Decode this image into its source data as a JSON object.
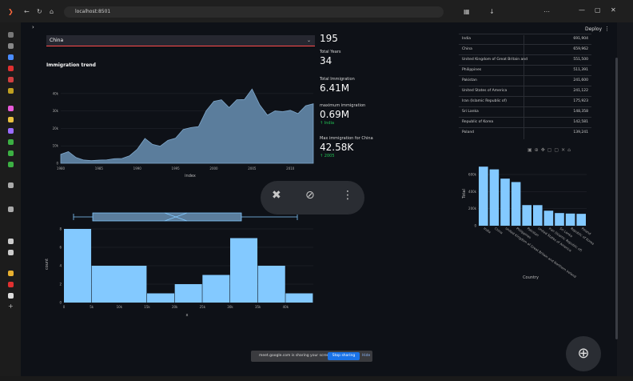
{
  "browser": {
    "url": "localhost:8501",
    "window_controls": [
      "—",
      "▢",
      "✕"
    ]
  },
  "header": {
    "deploy_label": "Deploy",
    "menu_label": "⋮",
    "sidebar_toggle": "›"
  },
  "country_select": {
    "value": "China"
  },
  "trend_chart": {
    "title": "Immigration trend",
    "xlabel": "index"
  },
  "metrics": {
    "top_value": "195",
    "total_years_label": "Total Years",
    "total_years_value": "34",
    "total_immigration_label": "Total Immigration",
    "total_immigration_value": "6.41M",
    "max_immigration_label": "maximum immigration",
    "max_immigration_value": "0.69M",
    "max_immigration_delta": "India",
    "max_for_country_label": "Max immigration for China",
    "max_for_country_value": "42.58K",
    "max_for_country_delta": "2005"
  },
  "top_table": {
    "rows": [
      {
        "country": "India",
        "value": "691,904"
      },
      {
        "country": "China",
        "value": "659,962"
      },
      {
        "country": "United Kingdom of Great Britain and",
        "value": "551,500"
      },
      {
        "country": "Philippines",
        "value": "511,391"
      },
      {
        "country": "Pakistan",
        "value": "241,600"
      },
      {
        "country": "United States of America",
        "value": "241,122"
      },
      {
        "country": "Iran (Islamic Republic of)",
        "value": "175,923"
      },
      {
        "country": "Sri Lanka",
        "value": "148,358"
      },
      {
        "country": "Republic of Korea",
        "value": "142,581"
      },
      {
        "country": "Poland",
        "value": "139,241"
      }
    ]
  },
  "floating_toolbar": {
    "icons": [
      "pin-off-icon",
      "eye-off-icon",
      "more-vert-icon"
    ]
  },
  "share_bar": {
    "text": "meet.google.com is sharing your screen.",
    "stop_label": "Stop sharing",
    "hide_label": "Hide"
  },
  "chart_data": [
    {
      "type": "area",
      "title": "Immigration trend",
      "xlabel": "index",
      "ylabel": "",
      "x": [
        1980,
        1981,
        1982,
        1983,
        1984,
        1985,
        1986,
        1987,
        1988,
        1989,
        1990,
        1991,
        1992,
        1993,
        1994,
        1995,
        1996,
        1997,
        1998,
        1999,
        2000,
        2001,
        2002,
        2003,
        2004,
        2005,
        2006,
        2007,
        2008,
        2009,
        2010,
        2011,
        2012,
        2013
      ],
      "values": [
        5123,
        6682,
        3308,
        1863,
        1527,
        1816,
        1960,
        2643,
        2758,
        4323,
        8076,
        14255,
        10846,
        9817,
        13128,
        14398,
        19415,
        20475,
        21049,
        30069,
        35529,
        36434,
        31961,
        36439,
        36619,
        42584,
        33518,
        27642,
        30037,
        29622,
        30391,
        28502,
        33024,
        34129
      ],
      "xticks": [
        "1980",
        "1985",
        "1990",
        "1995",
        "2000",
        "2005",
        "2010"
      ],
      "yticks": [
        "0",
        "10k",
        "20k",
        "30k",
        "40k"
      ],
      "ylim": [
        0,
        45000
      ]
    },
    {
      "type": "bar",
      "title": "",
      "xlabel": "Country",
      "ylabel": "Total",
      "categories": [
        "India",
        "China",
        "United Kingdom of Great Britain and Northern Ireland",
        "Philippines",
        "Pakistan",
        "United States of America",
        "Iran (Islamic Republic of)",
        "Sri Lanka",
        "Republic of Korea",
        "Poland"
      ],
      "values": [
        691904,
        659962,
        551500,
        511391,
        241600,
        241122,
        175923,
        148358,
        142581,
        139241
      ],
      "yticks": [
        "0",
        "200k",
        "400k",
        "600k"
      ],
      "ylim": [
        0,
        750000
      ]
    },
    {
      "type": "bar",
      "title": "",
      "xlabel": "x",
      "ylabel": "count",
      "categories": [
        "0-5k",
        "5k-15k",
        "15k-20k",
        "20k-25k",
        "25k-30k",
        "30k-35k",
        "35k-40k",
        "40k-45k"
      ],
      "values": [
        8,
        4,
        1,
        2,
        3,
        7,
        4,
        1
      ],
      "xticks": [
        "0",
        "5k",
        "10k",
        "15k",
        "20k",
        "25k",
        "30k",
        "35k",
        "40k"
      ],
      "yticks": [
        "0",
        "2",
        "4",
        "6",
        "8"
      ],
      "ylim": [
        0,
        8
      ],
      "colors": {
        "fill": "#83c9ff",
        "area_fill": "#5b7d9c"
      }
    }
  ]
}
